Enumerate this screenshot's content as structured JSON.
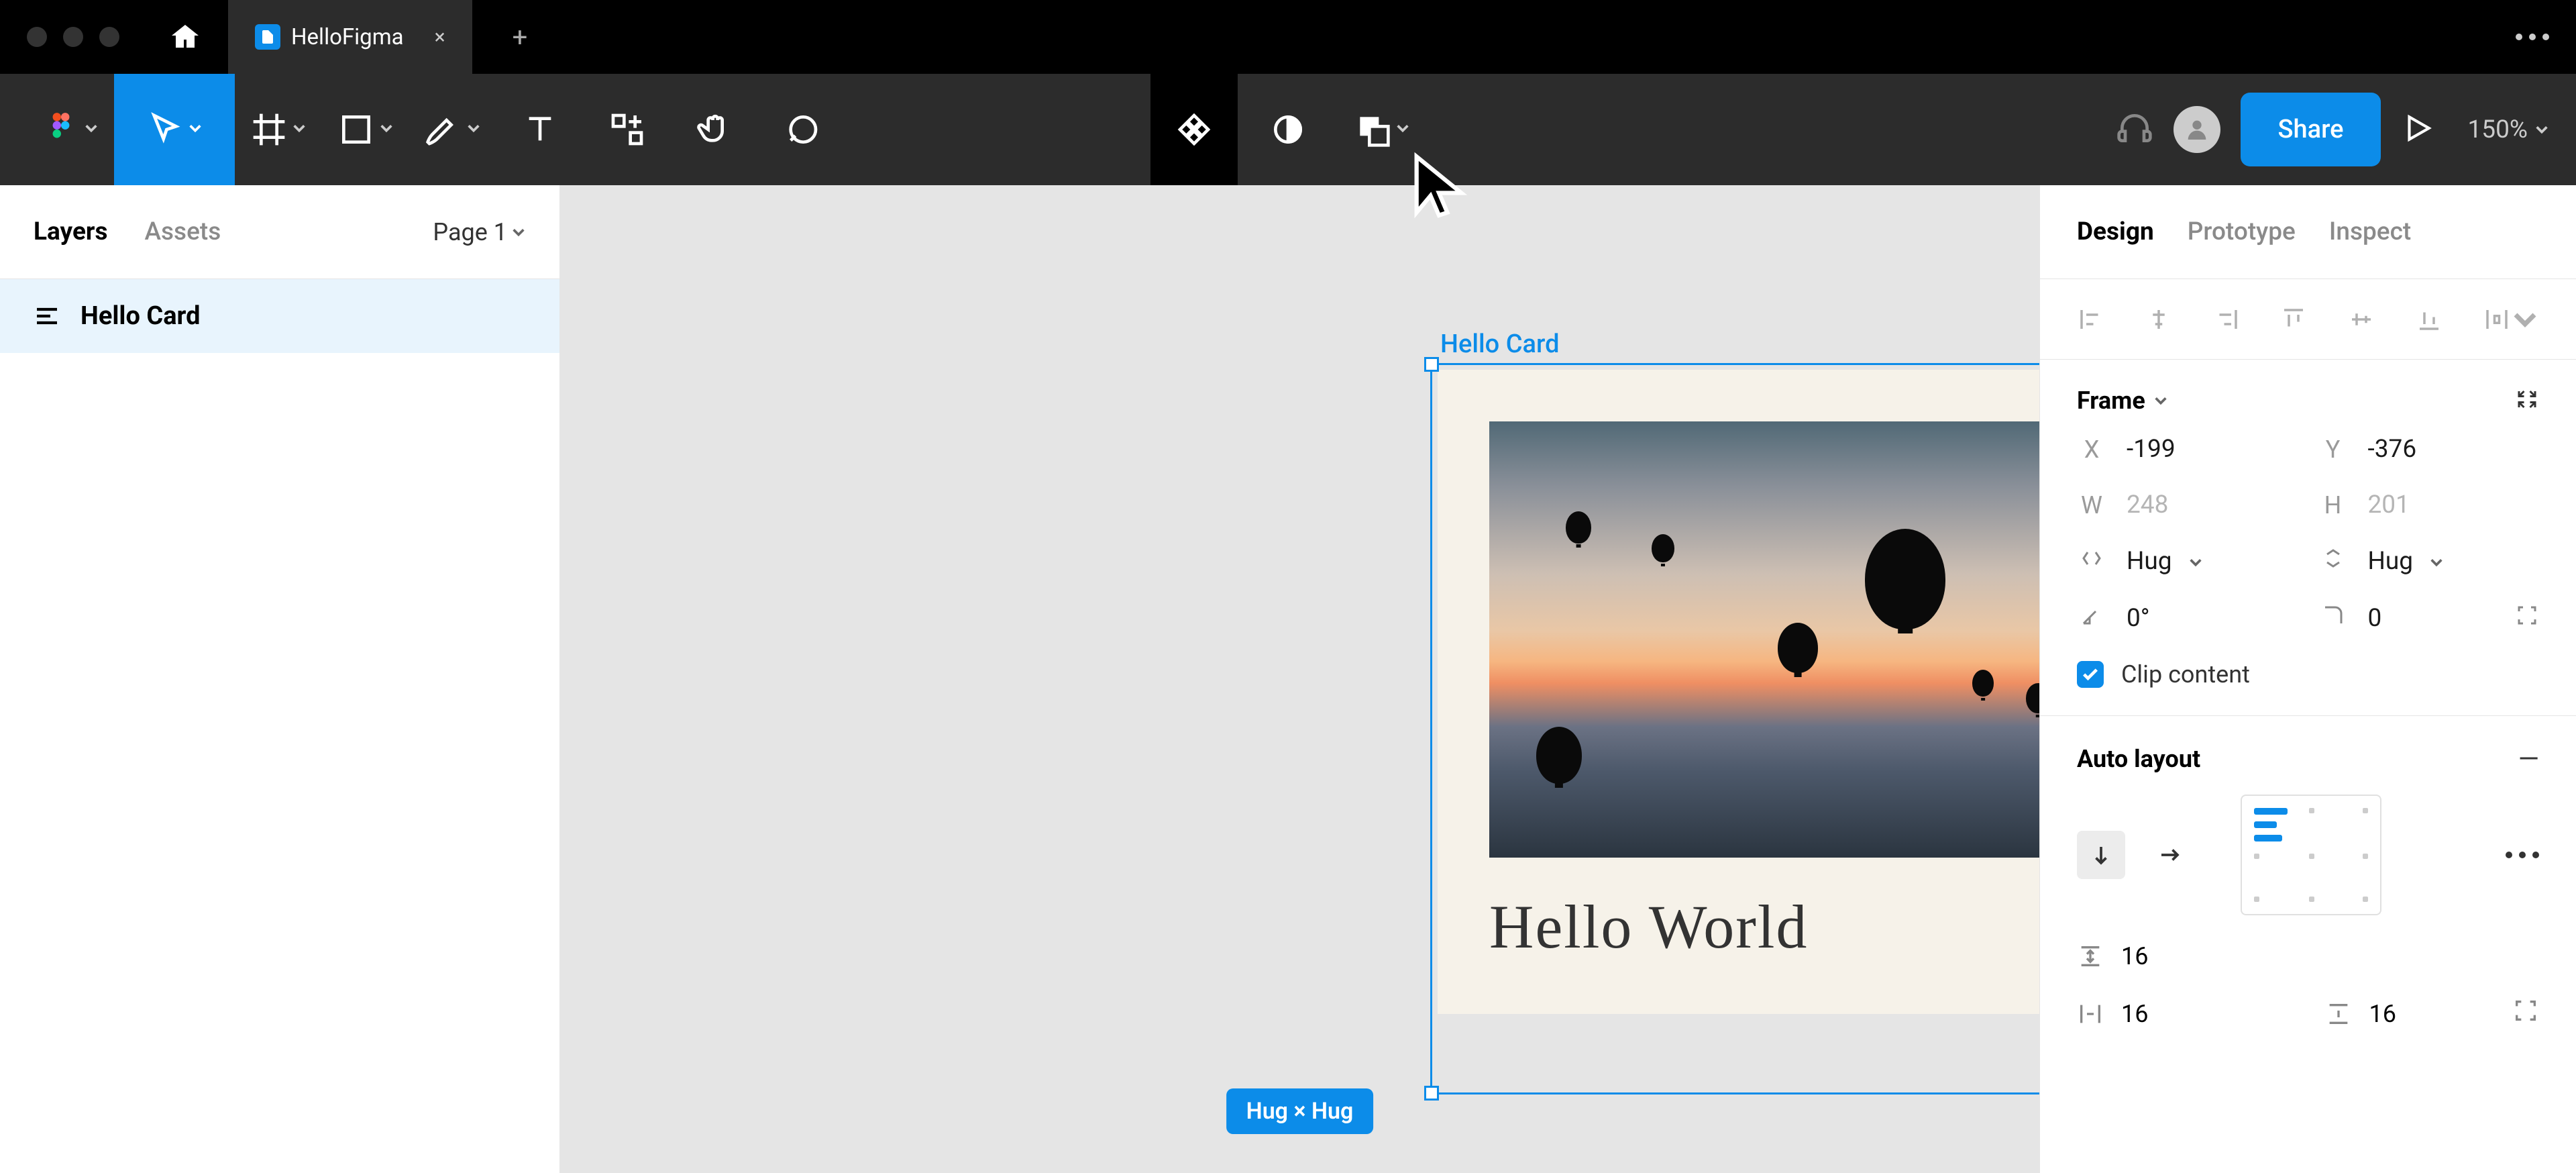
{
  "titlebar": {
    "tab_name": "HelloFigma",
    "tab_close": "×",
    "new_tab": "+"
  },
  "toolbar": {
    "zoom": "150%",
    "share": "Share"
  },
  "left_panel": {
    "tab_layers": "Layers",
    "tab_assets": "Assets",
    "page_selector": "Page 1",
    "layers": [
      {
        "name": "Hello Card"
      }
    ]
  },
  "canvas": {
    "frame_label": "Hello Card",
    "card_text": "Hello World",
    "size_badge": "Hug × Hug"
  },
  "right_panel": {
    "tabs": {
      "design": "Design",
      "prototype": "Prototype",
      "inspect": "Inspect"
    },
    "frame": {
      "title": "Frame",
      "x": "-199",
      "y": "-376",
      "w": "248",
      "h": "201",
      "w_mode": "Hug",
      "h_mode": "Hug",
      "rotation": "0°",
      "radius": "0",
      "clip_content": "Clip content"
    },
    "auto_layout": {
      "title": "Auto layout",
      "vspace": "16",
      "pad_h": "16",
      "pad_v": "16"
    }
  }
}
